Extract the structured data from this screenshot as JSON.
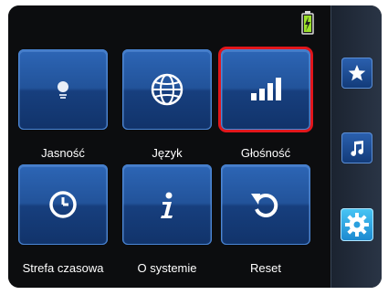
{
  "tiles": [
    {
      "label": "Jasność",
      "icon": "brightness-icon"
    },
    {
      "label": "Język",
      "icon": "globe-icon"
    },
    {
      "label": "Głośność",
      "icon": "volume-bars-icon",
      "selected": true
    },
    {
      "label": "Strefa czasowa",
      "icon": "clock-icon"
    },
    {
      "label": "O systemie",
      "icon": "info-icon"
    },
    {
      "label": "Reset",
      "icon": "reset-arrow-icon"
    }
  ],
  "sidebar": [
    {
      "icon": "star-icon"
    },
    {
      "icon": "music-note-icon"
    },
    {
      "icon": "gear-icon",
      "active": true
    }
  ],
  "colors": {
    "tile_blue": "#22539a",
    "selection_red": "#e1161c",
    "battery_green": "#9be02a"
  }
}
